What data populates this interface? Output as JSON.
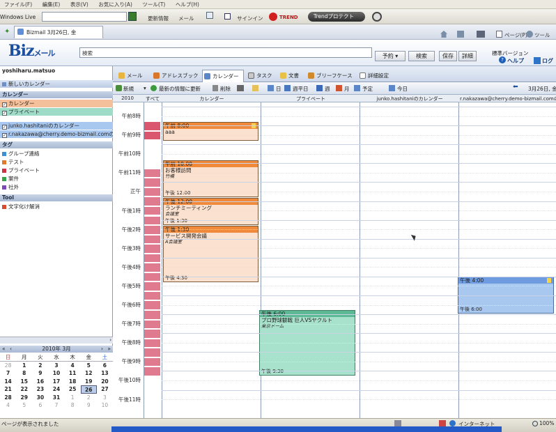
{
  "browser": {
    "menu": [
      "ファイル(F)",
      "編集(E)",
      "表示(V)",
      "お気に入り(A)",
      "ツール(T)",
      "ヘルプ(H)"
    ],
    "search_placeholder": "Windows Live",
    "toolbar_items": [
      "更新情報",
      "メール",
      "サインイン",
      "TREND",
      "Trendプロテクト"
    ],
    "tab_title": "Bizmail 3月26日, 金",
    "right_tools": [
      "ページ(P)",
      "ツール(O)"
    ]
  },
  "app": {
    "logo": "Biz",
    "logo_sub": "メール",
    "search_value": "検索",
    "header_buttons": [
      "予約",
      "検索",
      "保存",
      "詳細"
    ],
    "edition": "標準バージョン",
    "help": "ヘルプ",
    "logout": "ログ"
  },
  "sidebar": {
    "user": "yoshiharu.matsuo",
    "new_calendar": "新しいカレンダー",
    "calendars_title": "カレンダー",
    "calendars": [
      {
        "label": "カレンダー",
        "color": "#f3c09b"
      },
      {
        "label": "プライベート",
        "color": "#9fdcc8"
      },
      {
        "label": "junko.hashitaniのカレンダー",
        "color": "#a9c8ef"
      },
      {
        "label": "r.nakazawa@cherry.demo-bizmail.comの",
        "color": "#a9c8ef"
      }
    ],
    "tags_title": "タグ",
    "tags": [
      {
        "label": "グループ連絡",
        "color": "#3d8fd6"
      },
      {
        "label": "テスト",
        "color": "#e07a30"
      },
      {
        "label": "プライベート",
        "color": "#cc3344"
      },
      {
        "label": "案件",
        "color": "#33a44a"
      },
      {
        "label": "社外",
        "color": "#7b49b8"
      }
    ],
    "tool_title": "Tool",
    "tool_item": "文字化け解消"
  },
  "mini_calendar": {
    "title": "2010年 3月",
    "weekdays": [
      "日",
      "月",
      "火",
      "水",
      "木",
      "金",
      "土"
    ],
    "days": [
      [
        "28",
        "1",
        "2",
        "3",
        "4",
        "5",
        "6"
      ],
      [
        "7",
        "8",
        "9",
        "10",
        "11",
        "12",
        "13"
      ],
      [
        "14",
        "15",
        "16",
        "17",
        "18",
        "19",
        "20"
      ],
      [
        "21",
        "22",
        "23",
        "24",
        "25",
        "26",
        "27"
      ],
      [
        "28",
        "29",
        "30",
        "31",
        "1",
        "2",
        "3"
      ],
      [
        "4",
        "5",
        "6",
        "7",
        "8",
        "9",
        "10"
      ]
    ],
    "today": "26"
  },
  "tabs": [
    "メール",
    "アドレスブック",
    "カレンダー",
    "タスク",
    "文書",
    "ブリーフケース",
    "詳細設定"
  ],
  "calendar_toolbar": [
    "新規",
    "最新の情報に更新",
    "削除",
    "日",
    "週平日",
    "週",
    "月",
    "予定",
    "今日"
  ],
  "date_label": "3月26日, 金",
  "columns": {
    "year": "2010",
    "all": "すべて",
    "cols": [
      "カレンダー",
      "プライベート",
      "junko.hashitaniのカレンダー",
      "r.nakazawa@cherry.demo-bizmail.comのカ"
    ]
  },
  "hours": [
    "午前8時",
    "午前9時",
    "午前10時",
    "午前11時",
    "正午",
    "午後1時",
    "午後2時",
    "午後3時",
    "午後4時",
    "午後5時",
    "午後6時",
    "午後7時",
    "午後8時",
    "午後9時",
    "午後10時",
    "午後11時"
  ],
  "events": [
    {
      "start": "午前 8:00",
      "title": "aaa",
      "place": "",
      "end": ""
    },
    {
      "start": "午前 10:00",
      "title": "お客様訪問",
      "place": "竹橋",
      "end": "午後 12:00"
    },
    {
      "start": "午後 12:00",
      "title": "ランチミーティング",
      "place": "会議室",
      "end": "午後 1:30"
    },
    {
      "start": "午後 1:30",
      "title": "サービス開発会議",
      "place": "A会議室",
      "end": "午後 4:30"
    },
    {
      "start": "午後 6:00",
      "title": "プロ野球観戦 巨人VSヤクルト",
      "place": "東京ドーム",
      "end": "午後 9:30"
    },
    {
      "start": "午後 4:00",
      "title": "",
      "place": "",
      "end": "午後 6:00"
    }
  ],
  "status": {
    "left": "ページが表示されました",
    "zone": "インターネット",
    "zoom": "100%"
  }
}
